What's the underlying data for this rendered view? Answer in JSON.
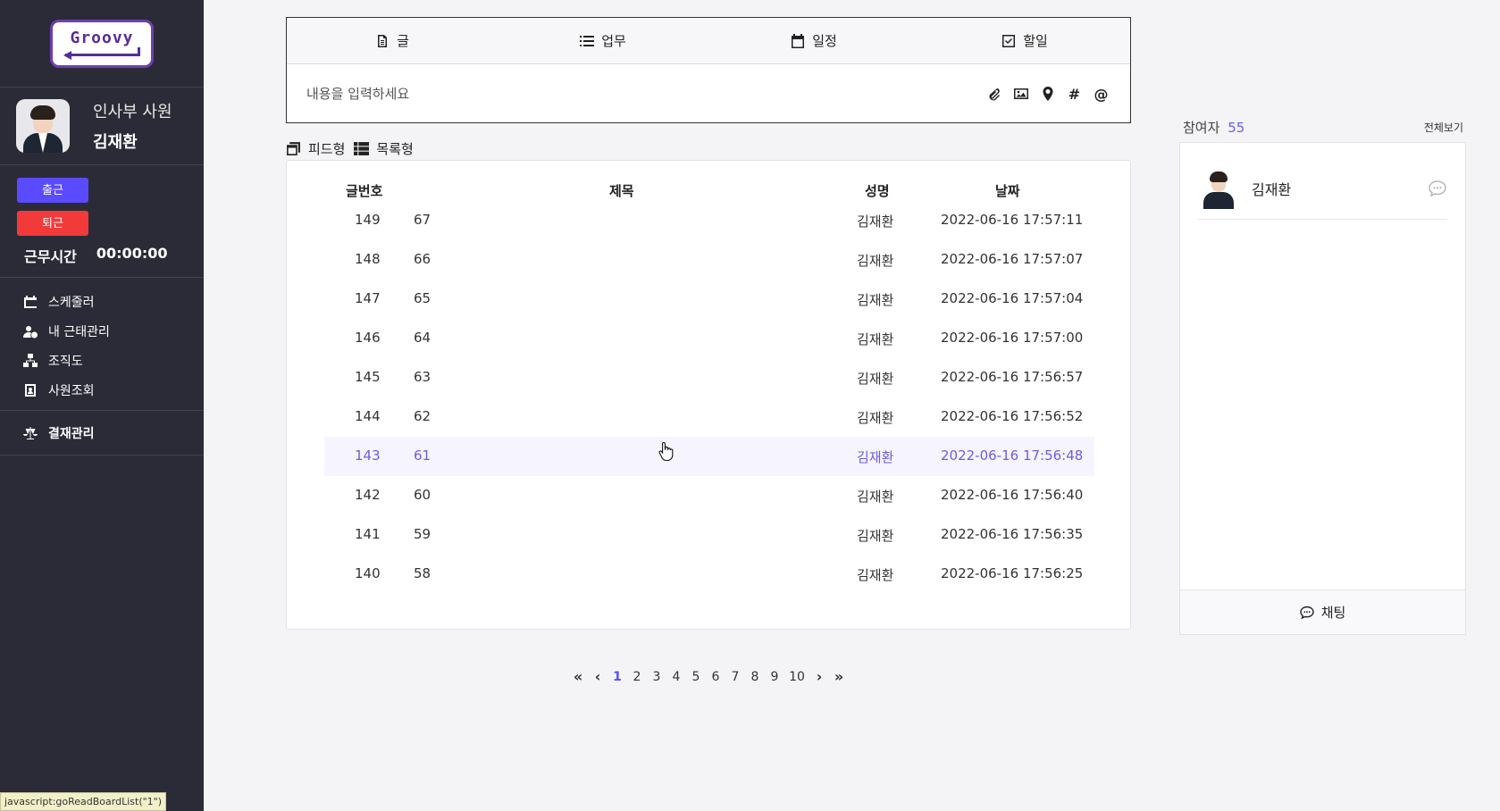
{
  "app": {
    "logo_text": "Groovy"
  },
  "profile": {
    "dept": "인사부 사원",
    "name": "김재환"
  },
  "attendance": {
    "check_in": "출근",
    "check_out": "퇴근",
    "work_time_label": "근무시간",
    "work_time_value": "00:00:00"
  },
  "menu": {
    "items": [
      {
        "label": "스케줄러",
        "icon": "calendar-icon"
      },
      {
        "label": "내 근태관리",
        "icon": "user-clock-icon"
      },
      {
        "label": "조직도",
        "icon": "org-chart-icon"
      },
      {
        "label": "사원조회",
        "icon": "contact-card-icon"
      }
    ],
    "approval": {
      "label": "결재관리",
      "icon": "scale-icon"
    }
  },
  "status_url": "javascript:goReadBoardList(\"1\")",
  "composer": {
    "tabs": [
      {
        "label": "글",
        "icon": "document-icon"
      },
      {
        "label": "업무",
        "icon": "list-icon"
      },
      {
        "label": "일정",
        "icon": "calendar-icon"
      },
      {
        "label": "할일",
        "icon": "checkbox-icon"
      }
    ],
    "placeholder": "내용을 입력하세요"
  },
  "view_toggle": {
    "feed": "피드형",
    "list": "목록형"
  },
  "board": {
    "headers": {
      "no": "글번호",
      "title": "제목",
      "author": "성명",
      "date": "날짜"
    },
    "rows": [
      {
        "no": "149",
        "title": "67",
        "author": "김재환",
        "date": "2022-06-16 17:57:11"
      },
      {
        "no": "148",
        "title": "66",
        "author": "김재환",
        "date": "2022-06-16 17:57:07"
      },
      {
        "no": "147",
        "title": "65",
        "author": "김재환",
        "date": "2022-06-16 17:57:04"
      },
      {
        "no": "146",
        "title": "64",
        "author": "김재환",
        "date": "2022-06-16 17:57:00"
      },
      {
        "no": "145",
        "title": "63",
        "author": "김재환",
        "date": "2022-06-16 17:56:57"
      },
      {
        "no": "144",
        "title": "62",
        "author": "김재환",
        "date": "2022-06-16 17:56:52"
      },
      {
        "no": "143",
        "title": "61",
        "author": "김재환",
        "date": "2022-06-16 17:56:48"
      },
      {
        "no": "142",
        "title": "60",
        "author": "김재환",
        "date": "2022-06-16 17:56:40"
      },
      {
        "no": "141",
        "title": "59",
        "author": "김재환",
        "date": "2022-06-16 17:56:35"
      },
      {
        "no": "140",
        "title": "58",
        "author": "김재환",
        "date": "2022-06-16 17:56:25"
      }
    ]
  },
  "pagination": {
    "first": "«",
    "prev": "‹",
    "pages": [
      "1",
      "2",
      "3",
      "4",
      "5",
      "6",
      "7",
      "8",
      "9",
      "10"
    ],
    "current": "1",
    "next": "›",
    "last": "»"
  },
  "participants": {
    "title": "참여자",
    "count": "55",
    "view_all": "전체보기",
    "users": [
      {
        "name": "김재환"
      }
    ],
    "chat_label": "채팅"
  },
  "colors": {
    "sidebar": "#2b2b37",
    "accent": "#5b4bff",
    "danger": "#f23a3a",
    "hover_row": "#f6f4ff"
  }
}
